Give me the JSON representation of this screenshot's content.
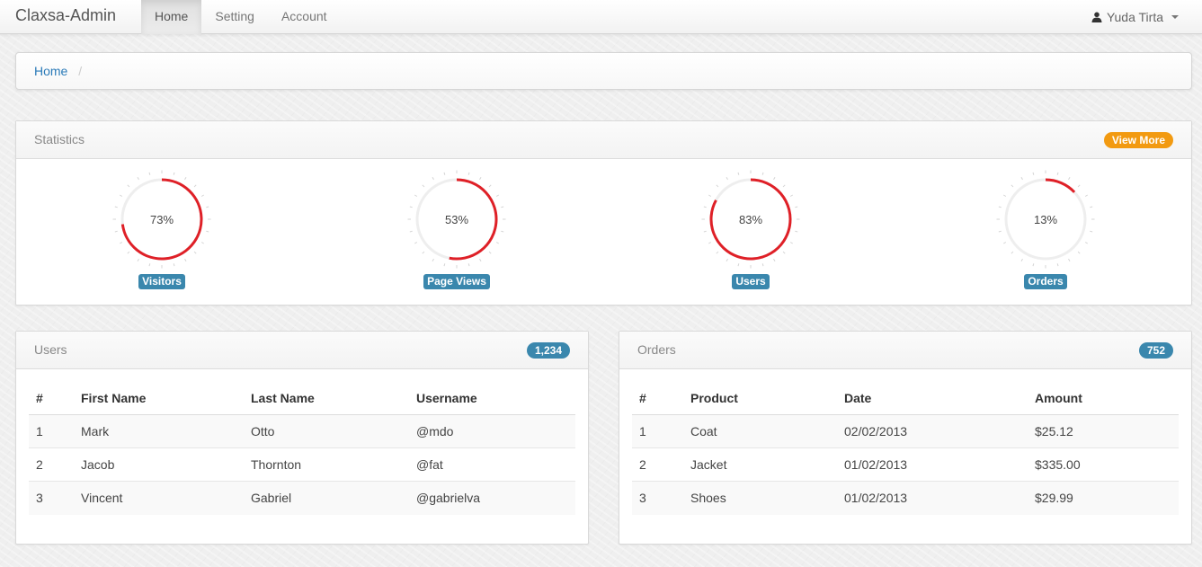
{
  "navbar": {
    "brand": "Claxsa-Admin",
    "items": [
      {
        "label": "Home",
        "active": true
      },
      {
        "label": "Setting",
        "active": false
      },
      {
        "label": "Account",
        "active": false
      }
    ],
    "user": "Yuda Tirta",
    "user_icon": "user-icon"
  },
  "breadcrumb": {
    "home": "Home",
    "separator": "/"
  },
  "statistics": {
    "title": "Statistics",
    "view_more": "View More",
    "gauges": [
      {
        "value": 73,
        "text": "73%",
        "label": "Visitors"
      },
      {
        "value": 53,
        "text": "53%",
        "label": "Page Views"
      },
      {
        "value": 83,
        "text": "83%",
        "label": "Users"
      },
      {
        "value": 13,
        "text": "13%",
        "label": "Orders"
      }
    ],
    "colors": {
      "arc": "#df2027",
      "track": "#eeeeee",
      "label_bg": "#3a87ad",
      "view_more_bg": "#f29a11"
    }
  },
  "users": {
    "title": "Users",
    "count": "1,234",
    "columns": [
      "#",
      "First Name",
      "Last Name",
      "Username"
    ],
    "rows": [
      [
        "1",
        "Mark",
        "Otto",
        "@mdo"
      ],
      [
        "2",
        "Jacob",
        "Thornton",
        "@fat"
      ],
      [
        "3",
        "Vincent",
        "Gabriel",
        "@gabrielva"
      ]
    ]
  },
  "orders": {
    "title": "Orders",
    "count": "752",
    "columns": [
      "#",
      "Product",
      "Date",
      "Amount"
    ],
    "rows": [
      [
        "1",
        "Coat",
        "02/02/2013",
        "$25.12"
      ],
      [
        "2",
        "Jacket",
        "01/02/2013",
        "$335.00"
      ],
      [
        "3",
        "Shoes",
        "01/02/2013",
        "$29.99"
      ]
    ]
  }
}
